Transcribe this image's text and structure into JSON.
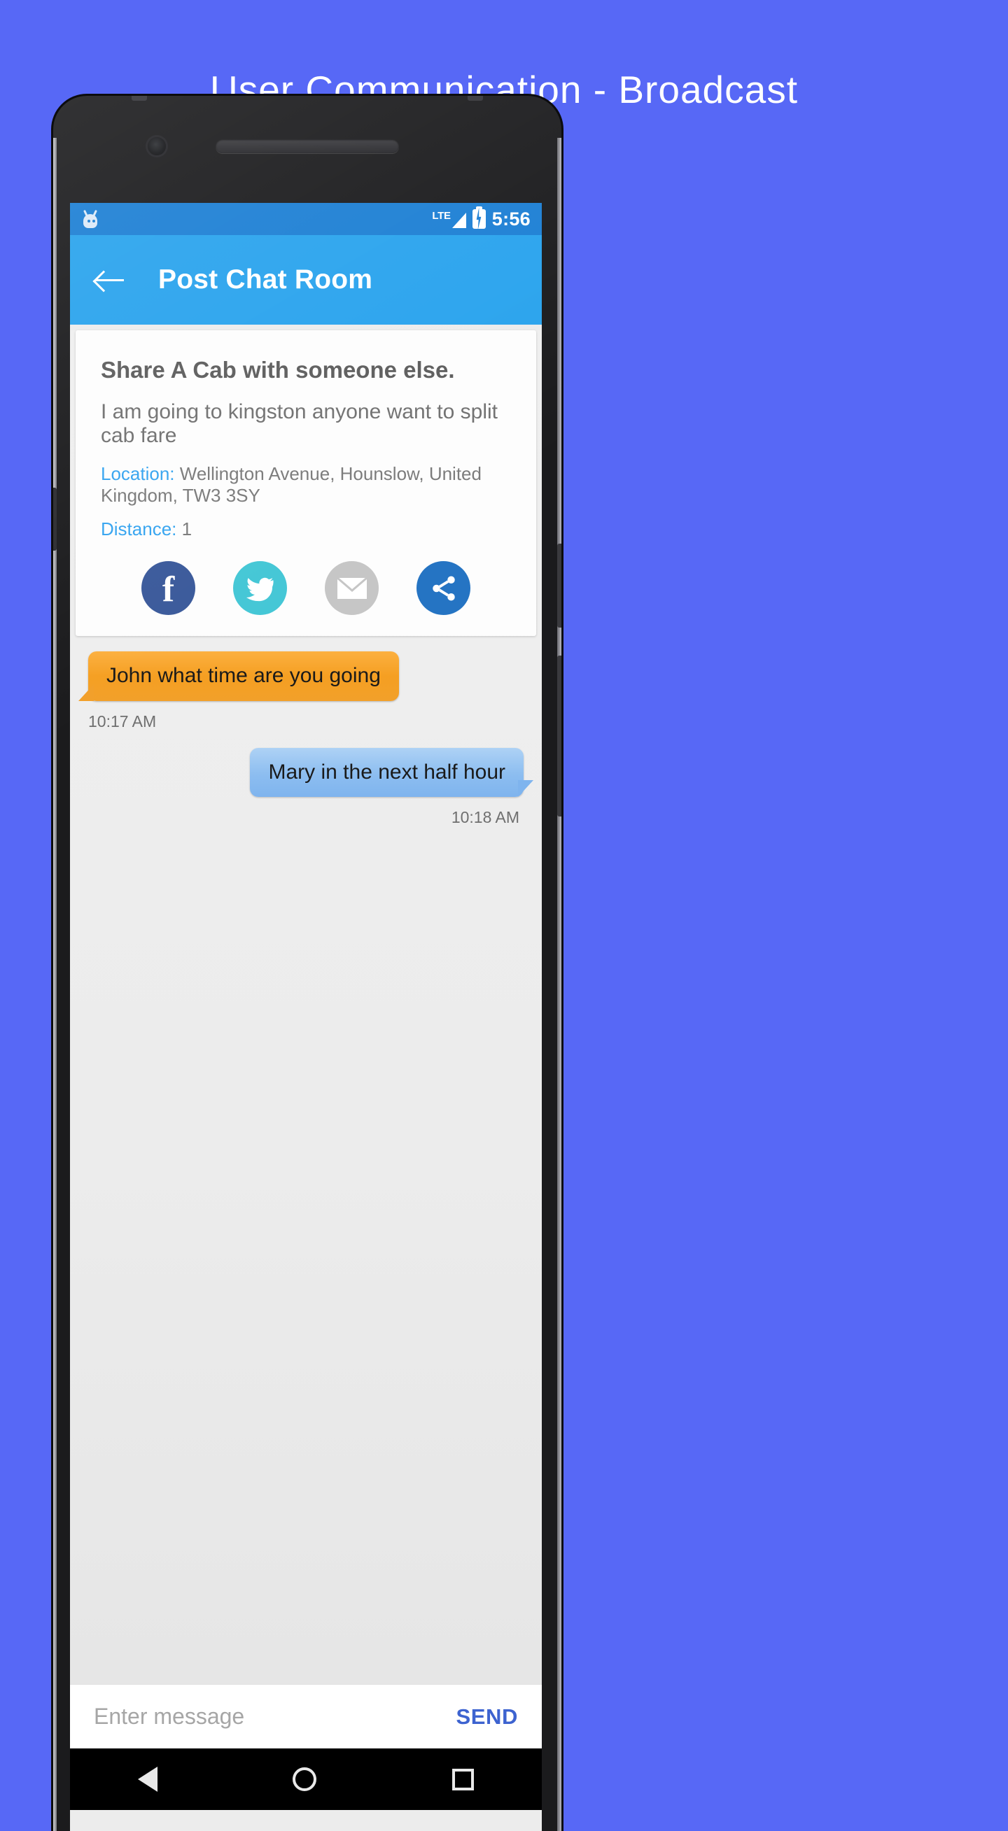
{
  "page": {
    "title": "User Communication - Broadcast",
    "background_color": "#5768f6"
  },
  "status_bar": {
    "icon": "android-robot-icon",
    "network": "LTE",
    "signal_icon": "signal-bars-icon",
    "battery_icon": "battery-charging-icon",
    "time": "5:56",
    "background_color": "#1c7fd4"
  },
  "app_bar": {
    "back_icon": "arrow-left-icon",
    "title": "Post Chat Room",
    "background_color": "#29a3ed"
  },
  "post_card": {
    "title": "Share A Cab with someone else.",
    "description": "I am going to kingston anyone want to split cab fare",
    "location_label": "Location:",
    "location_value": "Wellington Avenue, Hounslow, United Kingdom, TW3 3SY",
    "distance_label": "Distance:",
    "distance_value": "1",
    "label_color": "#35a4f0",
    "share_buttons": [
      {
        "name": "facebook",
        "icon": "facebook-icon",
        "color": "#3b5a9b"
      },
      {
        "name": "twitter",
        "icon": "twitter-icon",
        "color": "#45c7d6"
      },
      {
        "name": "email",
        "icon": "email-icon",
        "color": "#c6c6c6"
      },
      {
        "name": "share",
        "icon": "share-icon",
        "color": "#2574c3"
      }
    ]
  },
  "messages": [
    {
      "side": "left",
      "text": "John what time are you going",
      "timestamp": "10:17 AM",
      "bubble_color": "#f5a52a"
    },
    {
      "side": "right",
      "text": "Mary in the next half hour",
      "timestamp": "10:18 AM",
      "bubble_color": "#8cbdf0"
    }
  ],
  "composer": {
    "placeholder": "Enter message",
    "value": "",
    "send_label": "SEND",
    "send_color": "#3d63d0"
  },
  "nav_bar": {
    "back_icon": "triangle-back-icon",
    "home_icon": "circle-home-icon",
    "recents_icon": "square-recents-icon"
  }
}
